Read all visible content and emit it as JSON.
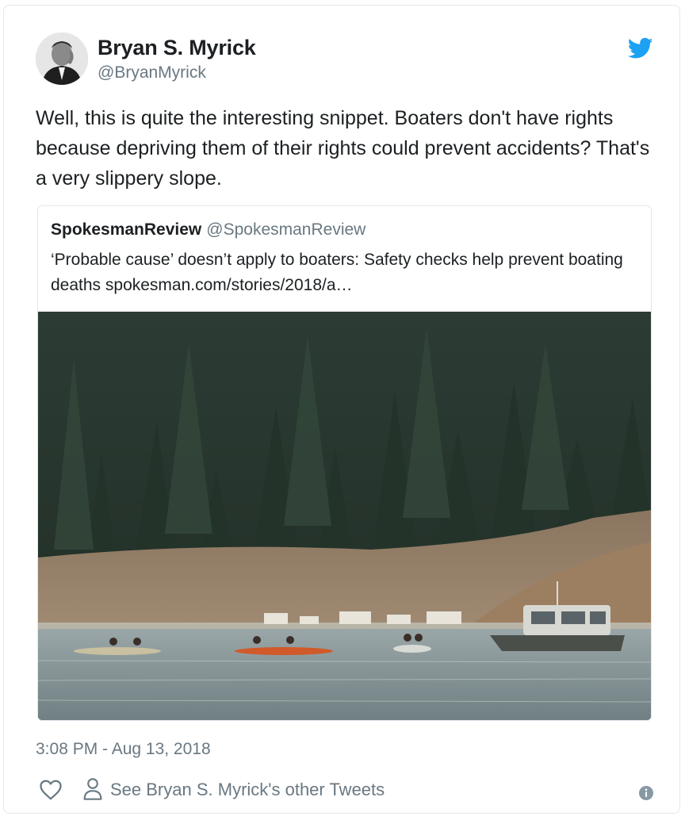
{
  "tweet": {
    "author": {
      "name": "Bryan S. Myrick",
      "handle": "@BryanMyrick",
      "avatar_icon": "user-avatar"
    },
    "text": "Well, this is quite the interesting snippet. Boaters don't have rights because depriving them of their rights could prevent accidents? That's a very slippery slope.",
    "quoted_tweet": {
      "author_name": "SpokesmanReview",
      "author_handle": "@SpokesmanReview",
      "text": "‘Probable cause’ doesn’t apply to boaters: Safety checks help prevent boating deaths spokesman.com/stories/2018/a…",
      "photo_icon": "lake-boats-photo"
    },
    "timestamp": "3:08 PM - Aug 13, 2018",
    "actions": {
      "like_icon": "heart-icon",
      "profile_icon": "person-icon",
      "other_tweets_label": "See Bryan S. Myrick's other Tweets",
      "info_icon": "info-icon"
    }
  },
  "colors": {
    "text": "#1c2022",
    "muted": "#697882",
    "twitter_blue": "#1da1f2",
    "border": "#e1e8ed"
  }
}
